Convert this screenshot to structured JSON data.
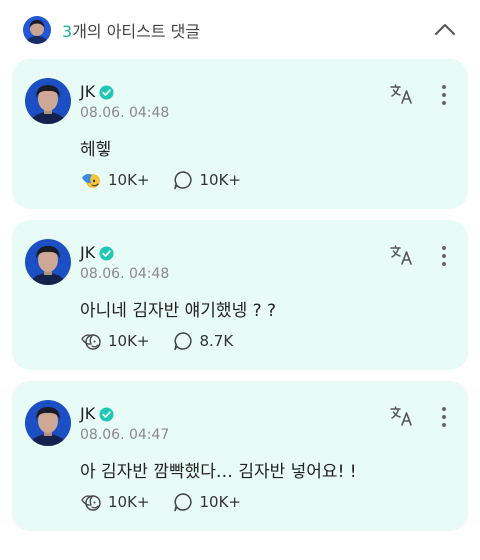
{
  "header": {
    "count": "3",
    "title_suffix": "개의 아티스트 댓글",
    "collapse_icon": "chevron-up-icon",
    "avatar_icon": "artist-avatar"
  },
  "comments": [
    {
      "author": "JK",
      "verified_icon": "verified-badge-icon",
      "timestamp": "08.06. 04:48",
      "text": "헤헿",
      "reaction_icon": "colored-reaction-icon",
      "reactions": "10K+",
      "replies": "10K+"
    },
    {
      "author": "JK",
      "verified_icon": "verified-badge-icon",
      "timestamp": "08.06. 04:48",
      "text": "아니네 김자반 얘기했넹 ? ?",
      "reaction_icon": "reaction-outline-icon",
      "reactions": "10K+",
      "replies": "8.7K"
    },
    {
      "author": "JK",
      "verified_icon": "verified-badge-icon",
      "timestamp": "08.06. 04:47",
      "text": "아 김자반 깜빡했다… 김자반 넣어요! !",
      "reaction_icon": "reaction-outline-icon",
      "reactions": "10K+",
      "replies": "10K+"
    }
  ],
  "colors": {
    "accent": "#16b4a0",
    "card_bg": "#e9fbf6",
    "verified": "#1ec8b4",
    "avatar_bg": "#1d4fc4"
  }
}
